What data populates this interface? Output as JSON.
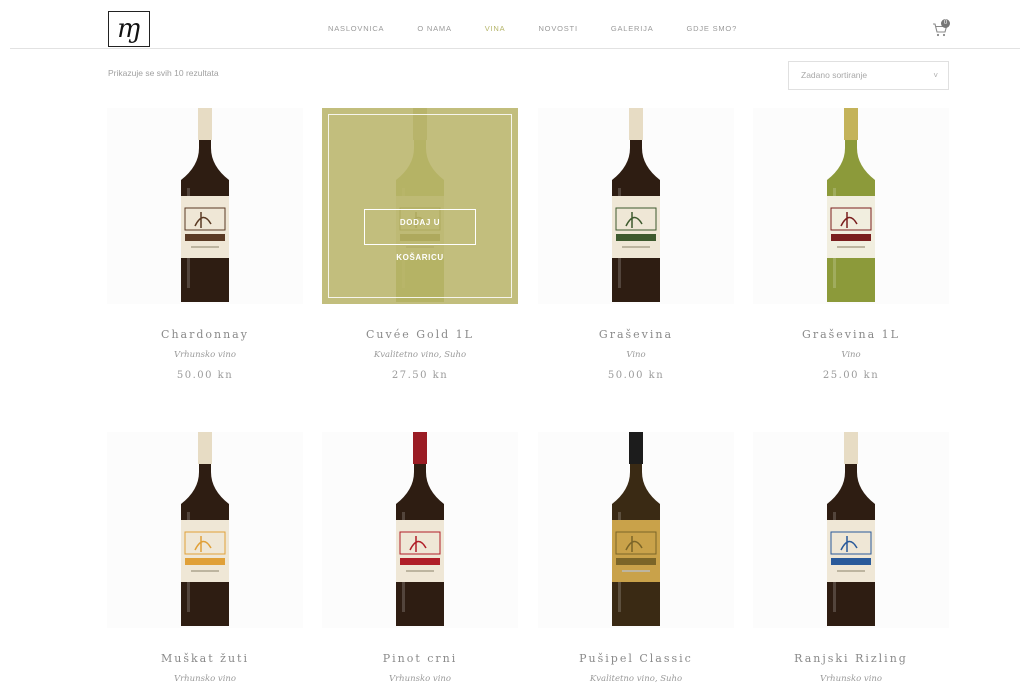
{
  "header": {
    "logo_text": "ɱ",
    "nav": [
      "NASLOVNICA",
      "O NAMA",
      "VINA",
      "NOVOSTI",
      "GALERIJA",
      "GDJE SMO?"
    ],
    "active_nav": "VINA",
    "cart_count": "0",
    "icons": {
      "cart": "cart-icon"
    }
  },
  "toolbar": {
    "result_count": "Prikazuje se svih 10 rezultata",
    "sort_selected": "Zadano sortiranje",
    "sort_chevron": "˅"
  },
  "products": [
    {
      "title": "Chardonnay",
      "category": "Vrhunsko vino",
      "price": "50.00 kn",
      "bottle": {
        "glass": "#2e1d12",
        "capsule": "#e7dcc4",
        "label": "#efe7d6",
        "band": "#5a3a24"
      }
    },
    {
      "title": "Cuvée Gold 1L",
      "category": "Kvalitetno vino, Suho",
      "price": "27.50 kn",
      "bottle": {
        "glass": "#b9c07a",
        "capsule": "#c9c99a",
        "label": "#e8e6cf",
        "band": "#8f8a4e"
      }
    },
    {
      "title": "Graševina",
      "category": "Vino",
      "price": "50.00 kn",
      "bottle": {
        "glass": "#2e1d12",
        "capsule": "#e7dcc4",
        "label": "#efe7d6",
        "band": "#3e5a2e"
      }
    },
    {
      "title": "Graševina 1L",
      "category": "Vino",
      "price": "25.00 kn",
      "bottle": {
        "glass": "#8c9a3a",
        "capsule": "#c4b35a",
        "label": "#f1eedf",
        "band": "#7a1e1e"
      }
    },
    {
      "title": "Muškat žuti",
      "category": "Vrhunsko vino",
      "price": "",
      "bottle": {
        "glass": "#2e1d12",
        "capsule": "#e7dcc4",
        "label": "#efe7d6",
        "band": "#e0a038"
      }
    },
    {
      "title": "Pinot crni",
      "category": "Vrhunsko vino",
      "price": "",
      "bottle": {
        "glass": "#2e1d12",
        "capsule": "#9a1c24",
        "label": "#efe7d6",
        "band": "#b01e28"
      }
    },
    {
      "title": "Pušipel Classic",
      "category": "Kvalitetno vino, Suho",
      "price": "",
      "bottle": {
        "glass": "#3a2a14",
        "capsule": "#1c1c1c",
        "label": "#c9a24a",
        "band": "#7b6528"
      }
    },
    {
      "title": "Ranjski Rizling",
      "category": "Vrhunsko vino",
      "price": "",
      "bottle": {
        "glass": "#2e1d12",
        "capsule": "#e7dcc4",
        "label": "#efe7d6",
        "band": "#2a5a9a"
      }
    }
  ],
  "hover_product": {
    "add_to_cart_line1": "DODAJ U",
    "add_to_cart_line2": "KOŠARICU"
  }
}
